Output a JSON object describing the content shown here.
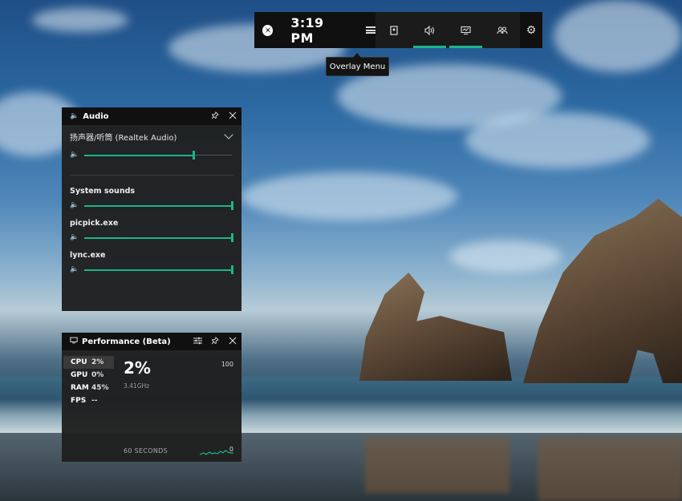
{
  "gamebar": {
    "time": "3:19 PM",
    "tooltip": "Overlay Menu",
    "buttons": [
      {
        "icon": "capture-icon",
        "active": false
      },
      {
        "icon": "audio-icon",
        "active": true
      },
      {
        "icon": "performance-icon",
        "active": true
      },
      {
        "icon": "xbox-social-icon",
        "active": false
      }
    ],
    "settings_icon": "gear-icon"
  },
  "audio": {
    "title": "Audio",
    "device": "扬声器/听筒 (Realtek Audio)",
    "master_volume": 0.74,
    "apps": [
      {
        "name": "System sounds",
        "volume": 1.0
      },
      {
        "name": "picpick.exe",
        "volume": 1.0
      },
      {
        "name": "lync.exe",
        "volume": 1.0
      }
    ],
    "accent": "#1bb58a"
  },
  "performance": {
    "title": "Performance (Beta)",
    "stats": [
      {
        "key": "CPU",
        "value": "2%",
        "selected": true
      },
      {
        "key": "GPU",
        "value": "0%",
        "selected": false
      },
      {
        "key": "RAM",
        "value": "45%",
        "selected": false
      },
      {
        "key": "FPS",
        "value": "--",
        "selected": false
      }
    ],
    "current": "2%",
    "frequency": "3.41GHz",
    "max_label": "100",
    "min_label": "0",
    "time_label": "60 SECONDS"
  }
}
